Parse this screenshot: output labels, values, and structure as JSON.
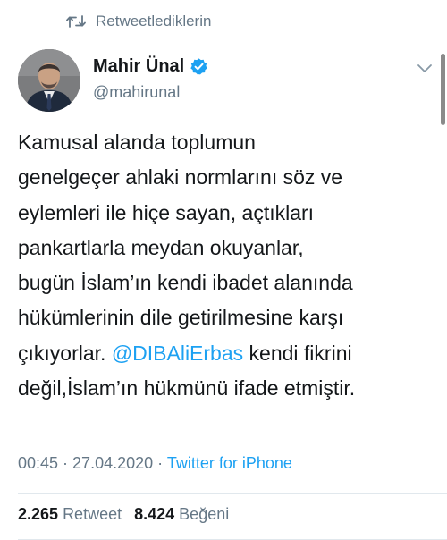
{
  "retweet_context": {
    "icon": "retweet-icon",
    "label": "Retweetlediklerin"
  },
  "author": {
    "display_name": "Mahir Ünal",
    "handle": "@mahirunal",
    "verified": true,
    "verified_icon": "verified-badge-icon",
    "menu_icon": "chevron-down-icon"
  },
  "tweet": {
    "lines": [
      "Kamusal alanda toplumun",
      "genelgeçer ahlaki normlarını söz ve",
      "eylemleri ile hiçe sayan, açtıkları",
      "pankartlarla meydan okuyanlar,",
      "bugün İslam’ın kendi ibadet alanında",
      "hükümlerinin dile getirilmesine karşı"
    ],
    "line7_before": "çıkıyorlar. ",
    "mention": "@DIBAliErbas",
    "line7_after": " kendi fikrini",
    "line8": "değil,İslam’ın hükmünü ifade etmiştir."
  },
  "meta": {
    "time": "00:45",
    "separator": " · ",
    "date": "27.04.2020",
    "source": "Twitter for iPhone"
  },
  "stats": {
    "retweet_count": "2.265",
    "retweet_label": "Retweet",
    "like_count": "8.424",
    "like_label": "Beğeni"
  },
  "colors": {
    "text": "#14171a",
    "secondary": "#657786",
    "link": "#1da1f2",
    "divider": "#e1e8ed"
  }
}
